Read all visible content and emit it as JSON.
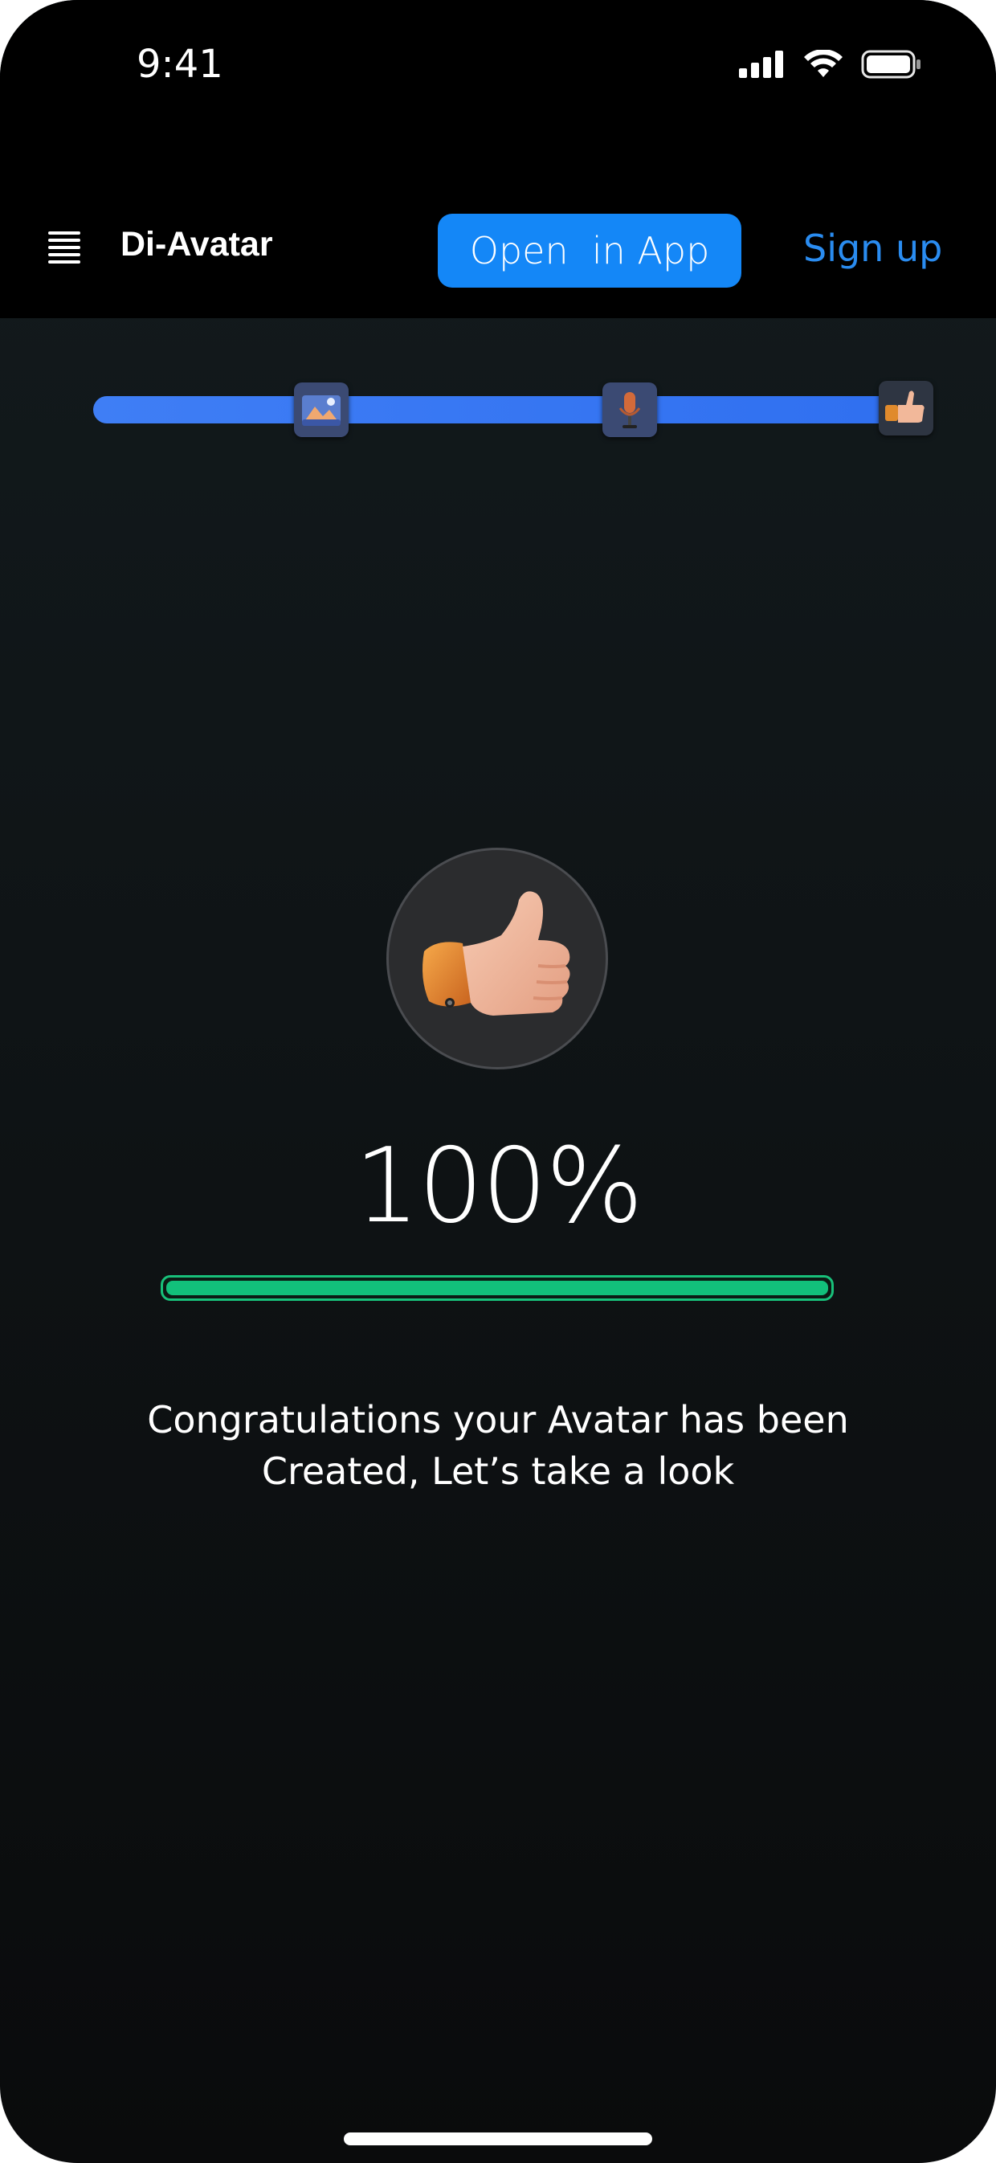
{
  "status_bar": {
    "time": "9:41",
    "icons": [
      "signal-icon",
      "wifi-icon",
      "battery-icon"
    ]
  },
  "header": {
    "menu_icon": "hamburger-menu-icon",
    "brand": "Di-Avatar",
    "open_app_label": "Open  in App",
    "signup_label": "Sign up"
  },
  "steps": {
    "icons": [
      "image-icon",
      "microphone-icon",
      "thumbs-up-icon"
    ],
    "progress": 1.0
  },
  "result": {
    "hero_icon": "thumbs-up-icon",
    "percent_text": "100%",
    "progress": 1.0,
    "message_line1": "Congratulations your Avatar has been",
    "message_line2": "Created, Let’s take a look"
  },
  "colors": {
    "accent": "#1487f7",
    "link": "#2a8cf0",
    "track": "#3f7ef5",
    "progress": "#12c07b",
    "background": "#0f1416"
  }
}
